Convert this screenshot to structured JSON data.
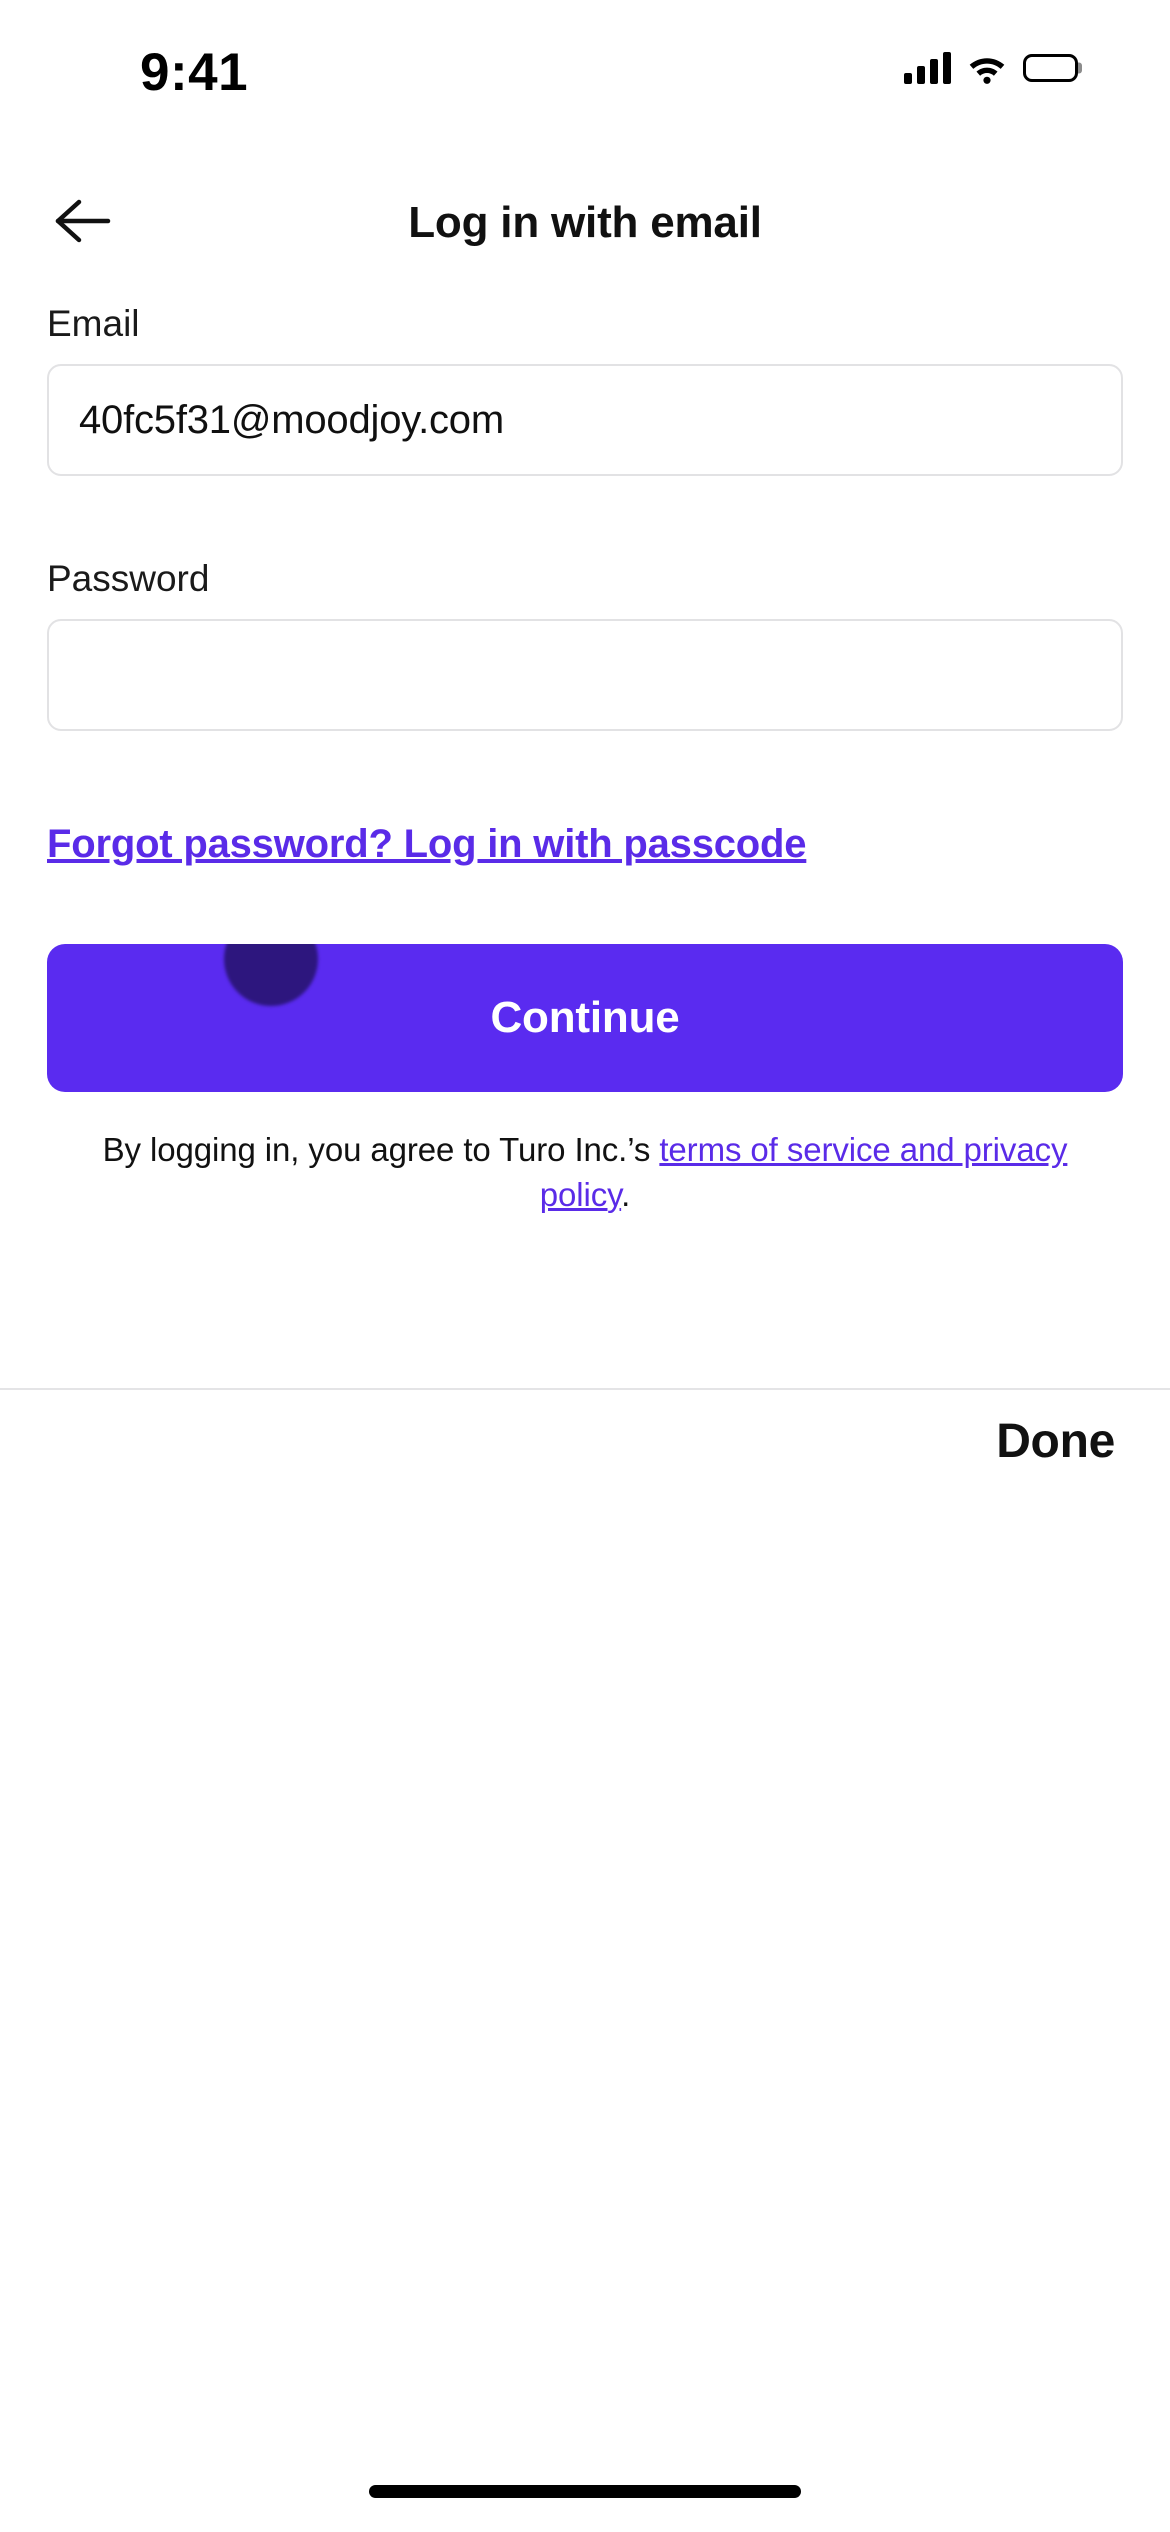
{
  "status_bar": {
    "time": "9:41",
    "cellular_icon": "cellular-bars-icon",
    "wifi_icon": "wifi-icon",
    "battery_icon": "battery-full-icon"
  },
  "header": {
    "back_icon": "back-arrow-icon",
    "title": "Log in with email"
  },
  "form": {
    "email": {
      "label": "Email",
      "value": "40fc5f31@moodjoy.com",
      "placeholder": "Email"
    },
    "password": {
      "label": "Password",
      "value": "",
      "placeholder": ""
    },
    "forgot_link": "Forgot password? Log in with passcode",
    "submit_label": "Continue"
  },
  "legal": {
    "prefix": "By logging in, you agree to Turo Inc.’s ",
    "link": "terms of service and privacy policy",
    "suffix": "."
  },
  "keyboard_accessory": {
    "done_label": "Done"
  },
  "colors": {
    "accent_purple": "#5A2BF0",
    "link_purple": "#5A2BE8",
    "text_primary": "#111111",
    "border_gray": "#E2E2E4",
    "background": "#FFFFFF"
  }
}
